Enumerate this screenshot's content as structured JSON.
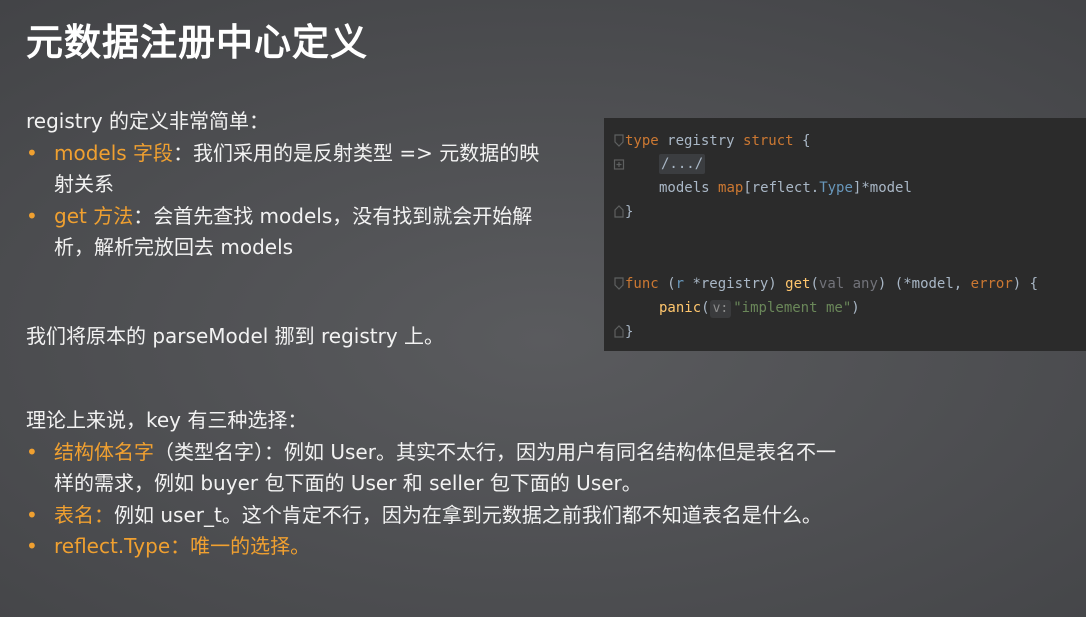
{
  "title": "元数据注册中心定义",
  "section1": {
    "intro": "registry 的定义非常简单：",
    "items": [
      {
        "highlight": "models 字段",
        "text": "：我们采用的是反射类型 => 元数据的映射关系"
      },
      {
        "highlight": "get 方法",
        "text": "：会首先查找 models，没有找到就会开始解析，解析完放回去 models"
      }
    ]
  },
  "section2": {
    "text": "我们将原本的 parseModel 挪到 registry 上。"
  },
  "section3": {
    "intro": "理论上来说，key 有三种选择：",
    "items": [
      {
        "highlight": "结构体名字",
        "text": "（类型名字）：例如 User。其实不太行，因为用户有同名结构体但是表名不一样的需求，例如 buyer 包下面的 User 和 seller 包下面的 User。"
      },
      {
        "highlight": "表名：",
        "text": "例如 user_t。这个肯定不行，因为在拿到元数据之前我们都不知道表名是什么。"
      },
      {
        "highlight": "reflect.Type：唯一的选择。",
        "text": ""
      }
    ]
  },
  "code": {
    "l1_kw1": "type",
    "l1_name": " registry ",
    "l1_kw2": "struct",
    "l1_rest": " {",
    "l2_fold": "/.../",
    "l3_field": "models ",
    "l3_map": "map",
    "l3_b1": "[",
    "l3_pkg": "reflect.",
    "l3_type": "Type",
    "l3_rest": "]*model",
    "l4": "}",
    "l5_kw": "func",
    "l5_p1": " (",
    "l5_r": "r",
    "l5_recv": " *registry) ",
    "l5_fn": "get",
    "l5_p2": "(",
    "l5_val": "val",
    "l5_any": " any",
    "l5_p3": ") (*model, ",
    "l5_err": "error",
    "l5_p4": ") {",
    "l6_fn": "panic",
    "l6_p1": "(",
    "l6_hint": "v:",
    "l6_str": "\"implement me\"",
    "l6_p2": ")",
    "l7": "}"
  },
  "colors": {
    "accent": "#f0a030",
    "code_bg": "#2b2b2b",
    "keyword": "#cc7832",
    "function": "#ffc66d",
    "string": "#6a8759",
    "type": "#6897bb"
  }
}
